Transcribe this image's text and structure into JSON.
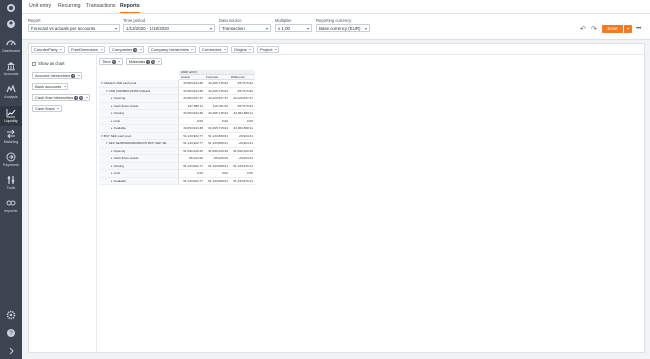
{
  "tabs": [
    "Unit entry",
    "Recurring",
    "Transactions",
    "Reports"
  ],
  "active_tab": "Reports",
  "sidebar": {
    "items": [
      {
        "label": "",
        "icon": "logo-icon"
      },
      {
        "label": "",
        "icon": "user-icon"
      },
      {
        "label": "Dashboard",
        "icon": "dashboard-icon"
      },
      {
        "label": "Accounts",
        "icon": "bank-icon"
      },
      {
        "label": "Analysis",
        "icon": "analysis-icon"
      },
      {
        "label": "Liquidity",
        "icon": "liquidity-icon"
      },
      {
        "label": "Matching",
        "icon": "matching-icon"
      },
      {
        "label": "Payments",
        "icon": "payments-icon"
      },
      {
        "label": "Tools",
        "icon": "tools-icon"
      },
      {
        "label": "Importer",
        "icon": "importer-icon"
      },
      {
        "label": "",
        "icon": "settings-icon"
      },
      {
        "label": "",
        "icon": "help-icon"
      },
      {
        "label": "",
        "icon": "expand-icon"
      }
    ],
    "active": "Liquidity"
  },
  "filters": {
    "report": {
      "label": "Report",
      "value": "Forecast vs actuals per accounts"
    },
    "time_period": {
      "label": "Time period",
      "value": "1/13/2020 - 1/19/2020"
    },
    "data_source": {
      "label": "Data source",
      "value": "Transaction"
    },
    "multiplier": {
      "label": "Multiplier",
      "value": "x 1,00"
    },
    "reporting_currency": {
      "label": "Reporting currency",
      "value": "Base currency (EUR)"
    }
  },
  "toolbar": {
    "save_label": "Save",
    "more_label": "•••",
    "undo": "↶",
    "redo": "↷"
  },
  "dimensions": [
    "CounterParty",
    "FreeDimension",
    "Companies",
    "Company hierarchies",
    "Currencies",
    "Origins",
    "Project"
  ],
  "left_pane": {
    "show_as_chart": "Show as chart",
    "selectors": [
      "Account hierarchies",
      "Bank accounts",
      "Cash flow hierarchies",
      "Cash flows"
    ]
  },
  "time_chips": [
    "Time",
    "Materials"
  ],
  "grid": {
    "period": "2020 w03",
    "columns": [
      "Actual",
      "Forecast",
      "Difference"
    ],
    "rows": [
      {
        "label": "Citibank USD cash pool",
        "indent": 0,
        "caret": "▾",
        "values": [
          "34,653,934.38",
          "34,295,715.64",
          "457,570.94"
        ]
      },
      {
        "label": "USD 1000000123456 Citibank",
        "indent": 1,
        "caret": "▾",
        "values": [
          "34,653,934.38",
          "34,295,715.64",
          "457,570.94"
        ]
      },
      {
        "label": "Opening",
        "indent": 2,
        "caret": "▸",
        "values": [
          "34,653,537.37",
          "34,226,537.37",
          "34,226,537.37"
        ]
      },
      {
        "label": "Cash flows simple",
        "indent": 2,
        "caret": "▸",
        "values": [
          "157,888.11",
          "116,781.82",
          "457,570.94"
        ]
      },
      {
        "label": "Closing",
        "indent": 2,
        "caret": "▸",
        "values": [
          "34,653,934.38",
          "34,295,715.64",
          "34,964,808.11"
        ]
      },
      {
        "label": "Limit",
        "indent": 2,
        "caret": "▸",
        "values": [
          "0.00",
          "0.00",
          "0.00"
        ]
      },
      {
        "label": "Available",
        "indent": 2,
        "caret": "▸",
        "values": [
          "34,653,934.38",
          "34,295,715.64",
          "34,964,808.11"
        ]
      },
      {
        "label": "BNY SEK cash pool",
        "indent": 0,
        "caret": "▾",
        "values": [
          "51,133,902.77",
          "51,133,808.61",
          "-29,904.31"
        ]
      },
      {
        "label": "SEK SE3650000000052070 BNY SEK SE",
        "indent": 1,
        "caret": "▾",
        "values": [
          "51,133,902.77",
          "51,133,808.61",
          "-29,904.31"
        ]
      },
      {
        "label": "Opening",
        "indent": 2,
        "caret": "▸",
        "values": [
          "51,090,229.36",
          "51,090,229.36",
          "51,090,229.36"
        ]
      },
      {
        "label": "Cash flows simple",
        "indent": 2,
        "caret": "▸",
        "values": [
          "-95,223.96",
          "-55,229.09",
          "-29,904.31"
        ]
      },
      {
        "label": "Closing",
        "indent": 2,
        "caret": "▸",
        "values": [
          "51,133,902.77",
          "51,133,808.61",
          "51,133,970.41"
        ]
      },
      {
        "label": "Limit",
        "indent": 2,
        "caret": "▸",
        "values": [
          "0.00",
          "0.00",
          "0.00"
        ]
      },
      {
        "label": "Available",
        "indent": 2,
        "caret": "▸",
        "values": [
          "51,133,902.77",
          "51,133,808.61",
          "51,133,970.41"
        ]
      }
    ]
  }
}
